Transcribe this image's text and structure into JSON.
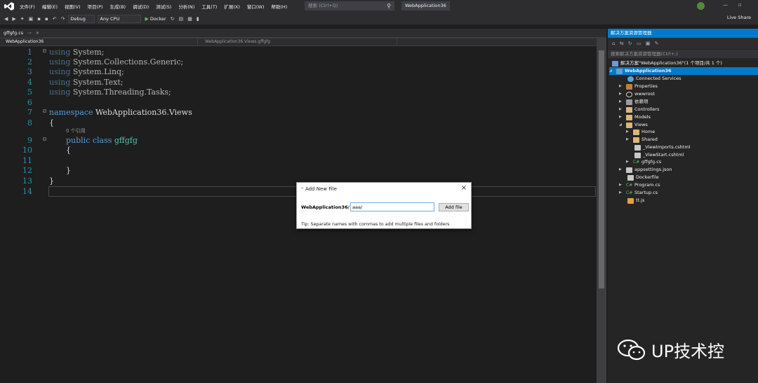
{
  "menubar": {
    "items": [
      "文件(F)",
      "编辑(E)",
      "视图(V)",
      "项目(P)",
      "生成(B)",
      "调试(D)",
      "测试(S)",
      "分析(N)",
      "工具(T)",
      "扩展(X)",
      "窗口(W)",
      "帮助(H)"
    ],
    "search_placeholder": "搜索 (Ctrl+Q)",
    "solution_name": "WebApplication36"
  },
  "toolbar": {
    "configuration": "Debug",
    "platform": "Any CPU",
    "run_target": "Docker",
    "live_share": "Live Share"
  },
  "document": {
    "tab_label": "gffgfg.cs",
    "nav_project": "WebApplication36",
    "nav_class": "WebApplication36.Views.gffgfg"
  },
  "editor": {
    "line_numbers": [
      "1",
      "2",
      "3",
      "4",
      "5",
      "6",
      "7",
      "8",
      "9",
      "10",
      "11",
      "12",
      "13",
      "14"
    ],
    "lines": {
      "l1_kw": "using",
      "l1_rest": " System;",
      "l2_kw": "using",
      "l2_rest": " System.Collections.Generic;",
      "l3_kw": "using",
      "l3_rest": " System.Linq;",
      "l4_kw": "using",
      "l4_rest": " System.Text;",
      "l5_kw": "using",
      "l5_rest": " System.Threading.Tasks;",
      "l7_kw": "namespace",
      "l7_rest": " WebApplication36.Views",
      "l8": "{",
      "codelens": "0 个引用",
      "l9_kw": "public class",
      "l9_type": "gffgfg",
      "l10": "{",
      "l12": "}",
      "l13": "}"
    }
  },
  "solution_explorer": {
    "title": "解决方案资源管理器",
    "search_placeholder": "搜索解决方案资源管理器(Ctrl+;)",
    "items": {
      "solution": "解决方案\"WebApplication36\"(1 个项目/共 1 个)",
      "project": "WebApplication36",
      "connected": "Connected Services",
      "properties": "Properties",
      "wwwroot": "wwwroot",
      "deps": "依赖项",
      "controllers": "Controllers",
      "models": "Models",
      "views": "Views",
      "home": "Home",
      "shared": "Shared",
      "viewimports": "_ViewImports.cshtml",
      "viewstart": "_ViewStart.cshtml",
      "gffgfg": "gffgfg.cs",
      "appsettings": "appsettings.json",
      "dockerfile": "Dockerfile",
      "program": "Program.cs",
      "startup": "Startup.cs",
      "ttjs": "tt.js"
    }
  },
  "dialog": {
    "title": "Add New File",
    "prefix": "WebApplication36/",
    "input_value": "aaa/",
    "button_label": "Add file",
    "tip": "Tip: Separate names with commas to add multiple files and folders"
  },
  "watermark": {
    "text": "UP技术控"
  },
  "colors": {
    "accent": "#007acc",
    "editor_bg": "#1e1e1e",
    "keyword": "#569cd6",
    "type": "#4ec9b0",
    "line_number": "#2b91af"
  }
}
